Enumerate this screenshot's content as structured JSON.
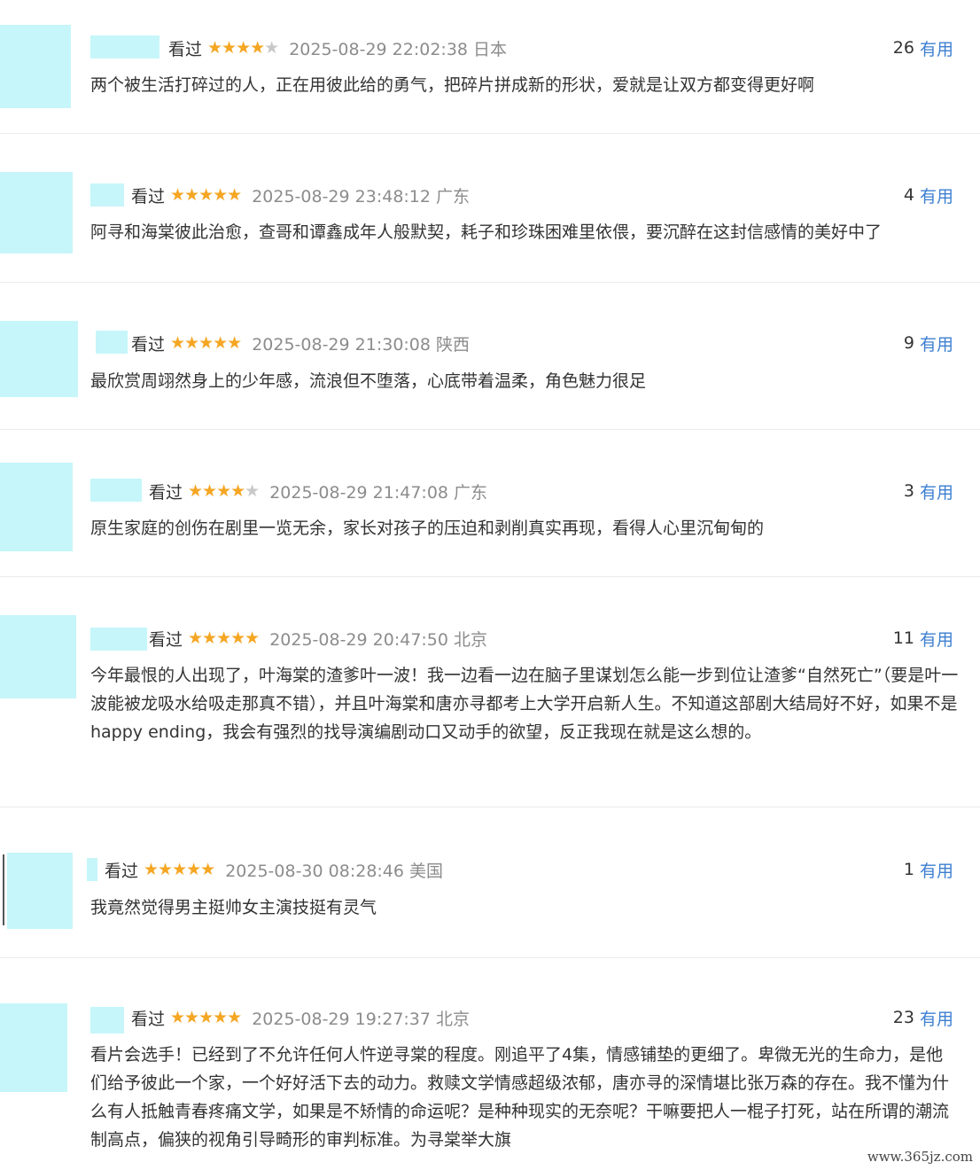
{
  "reviews": [
    {
      "status": "看过",
      "stars": 4,
      "time": "2025-08-29 22:02:38 日本",
      "count": "26",
      "useful": "有用",
      "text": "两个被生活打碎过的人，正在用彼此给的勇气，把碎片拼成新的形状，爱就是让双方都变得更好啊"
    },
    {
      "status": "看过",
      "stars": 5,
      "time": "2025-08-29 23:48:12 广东",
      "count": "4",
      "useful": "有用",
      "text": "阿寻和海棠彼此治愈，查哥和谭鑫成年人般默契，耗子和珍珠困难里依偎，要沉醉在这封信感情的美好中了"
    },
    {
      "status": "看过",
      "stars": 5,
      "time": "2025-08-29 21:30:08 陕西",
      "count": "9",
      "useful": "有用",
      "text": "最欣赏周翊然身上的少年感，流浪但不堕落，心底带着温柔，角色魅力很足"
    },
    {
      "status": "看过",
      "stars": 4,
      "time": "2025-08-29 21:47:08 广东",
      "count": "3",
      "useful": "有用",
      "text": "原生家庭的创伤在剧里一览无余，家长对孩子的压迫和剥削真实再现，看得人心里沉甸甸的"
    },
    {
      "status": "看过",
      "stars": 5,
      "time": "2025-08-29 20:47:50 北京",
      "count": "11",
      "useful": "有用",
      "text": "今年最恨的人出现了，叶海棠的渣爹叶一波！我一边看一边在脑子里谋划怎么能一步到位让渣爹“自然死亡”（要是叶一波能被龙吸水给吸走那真不错），并且叶海棠和唐亦寻都考上大学开启新人生。不知道这部剧大结局好不好，如果不是happy ending，我会有强烈的找导演编剧动口又动手的欲望，反正我现在就是这么想的。"
    },
    {
      "status": "看过",
      "stars": 5,
      "time": "2025-08-30 08:28:46 美国",
      "count": "1",
      "useful": "有用",
      "text": "我竟然觉得男主挺帅女主演技挺有灵气"
    },
    {
      "status": "看过",
      "stars": 5,
      "time": "2025-08-29 19:27:37 北京",
      "count": "23",
      "useful": "有用",
      "text": "看片会选手！已经到了不允许任何人忤逆寻棠的程度。刚追平了4集，情感铺垫的更细了。卑微无光的生命力，是他们给予彼此一个家，一个好好活下去的动力。救赎文学情感超级浓郁，唐亦寻的深情堪比张万森的存在。我不懂为什么有人抵触青春疼痛文学，如果是不矫情的命运呢？是种种现实的无奈呢？干嘛要把人一棍子打死，站在所谓的潮流制高点，偏狭的视角引导畸形的审判标准。为寻棠举大旗"
    }
  ],
  "watermark": "www.365jz.com",
  "colors": {
    "avatar": "#c6f6f9",
    "star": "#f5a623",
    "link": "#3d7fd1"
  }
}
